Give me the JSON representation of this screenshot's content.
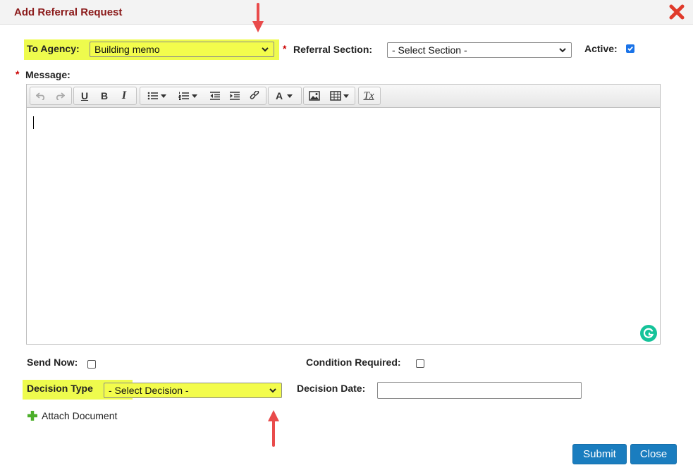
{
  "dialog": {
    "title": "Add Referral Request",
    "close_icon": "close-x-icon"
  },
  "form": {
    "to_agency": {
      "label": "To Agency:",
      "value": "Building memo"
    },
    "referral_section": {
      "required": "*",
      "label": "Referral Section:",
      "value": "- Select Section -"
    },
    "active": {
      "label": "Active:",
      "checked": true
    },
    "message": {
      "required": "*",
      "label": "Message:"
    },
    "send_now": {
      "label": "Send Now:",
      "checked": false
    },
    "condition_required": {
      "label": "Condition Required:",
      "checked": false
    },
    "decision_type": {
      "label": "Decision Type",
      "value": "- Select Decision -"
    },
    "decision_date": {
      "label": "Decision Date:",
      "value": ""
    },
    "attach_document": {
      "label": "Attach Document"
    }
  },
  "editor_toolbar": {
    "bold": "B",
    "italic": "I",
    "underline": "U",
    "font_color": "A",
    "clear_format": "Tx"
  },
  "buttons": {
    "submit": "Submit",
    "close": "Close"
  },
  "colors": {
    "title": "#8b1a1a",
    "highlight": "#eefb4d",
    "button": "#1a7dbf",
    "arrow": "#e94b4b"
  }
}
